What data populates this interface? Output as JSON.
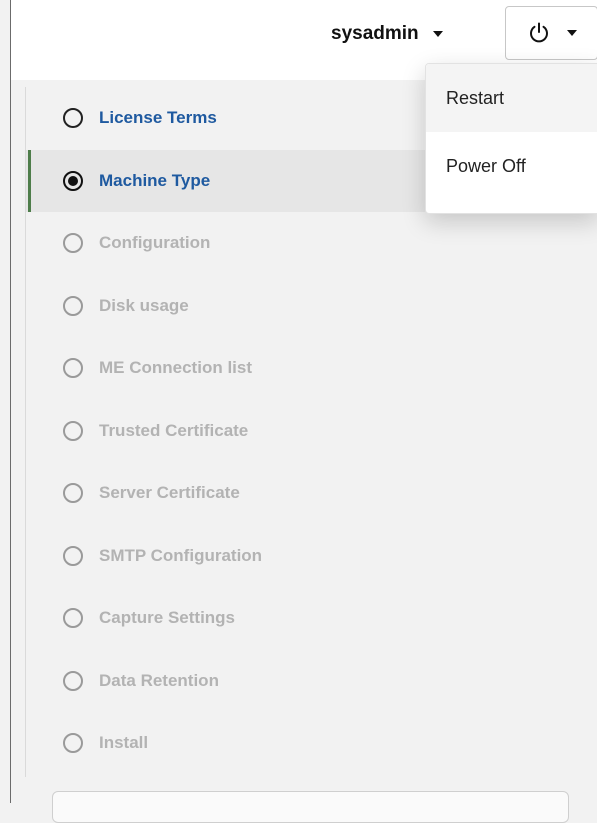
{
  "header": {
    "username": "sysadmin",
    "user_menu_icon": "chevron-down-icon",
    "power_icon": "power-icon"
  },
  "power_menu": {
    "items": [
      {
        "label": "Restart"
      },
      {
        "label": "Power Off"
      }
    ]
  },
  "wizard": {
    "active_step": "Machine Type",
    "steps": [
      {
        "label": "License Terms",
        "state": "done"
      },
      {
        "label": "Machine Type",
        "state": "active"
      },
      {
        "label": "Configuration",
        "state": "pending"
      },
      {
        "label": "Disk usage",
        "state": "pending"
      },
      {
        "label": "ME Connection list",
        "state": "pending"
      },
      {
        "label": "Trusted Certificate",
        "state": "pending"
      },
      {
        "label": "Server Certificate",
        "state": "pending"
      },
      {
        "label": "SMTP Configuration",
        "state": "pending"
      },
      {
        "label": "Capture Settings",
        "state": "pending"
      },
      {
        "label": "Data Retention",
        "state": "pending"
      },
      {
        "label": "Install",
        "state": "pending"
      }
    ]
  },
  "colors": {
    "link_blue": "#1f5aa0",
    "disabled_gray": "#b3b3b3",
    "active_bar_green": "#4e7d4a"
  }
}
